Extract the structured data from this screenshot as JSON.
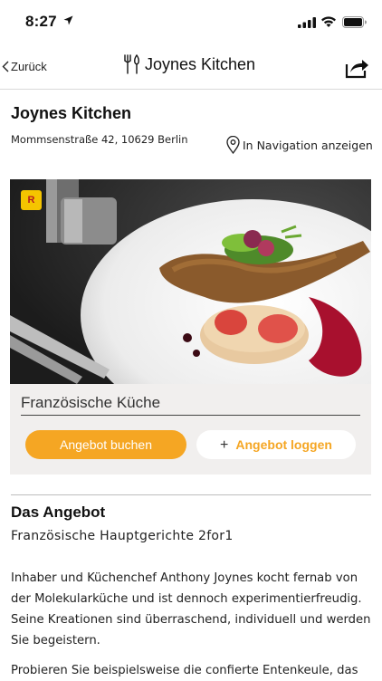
{
  "status_bar": {
    "time": "8:27"
  },
  "nav": {
    "back_label": "Zurück",
    "title": "Joynes Kitchen"
  },
  "restaurant": {
    "name": "Joynes Kitchen",
    "address": "Mommsenstraße 42, 10629 Berlin",
    "navigation_link": "In Navigation anzeigen",
    "badge": "R",
    "cuisine": "Französische Küche"
  },
  "actions": {
    "book_label": "Angebot buchen",
    "log_label": "Angebot loggen",
    "log_icon": "+"
  },
  "offer": {
    "heading": "Das Angebot",
    "subtitle": "Französische Hauptgerichte 2for1",
    "paragraph1": "Inhaber und Küchenchef Anthony Joynes kocht fernab von der Molekularküche und ist dennoch experimentierfreudig. Seine Kreationen sind überraschend, individuell und werden Sie begeistern.",
    "paragraph2": "Probieren Sie beispielsweise die confierte Entenkeule, das"
  },
  "colors": {
    "accent": "#f5a623",
    "badge_bg": "#f5c400",
    "card_bg": "#f1efee"
  }
}
